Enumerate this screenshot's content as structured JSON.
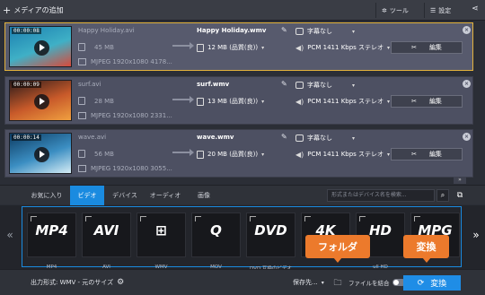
{
  "toolbar": {
    "add_media": "メディアの追加",
    "tools": "ツール",
    "settings": "設定"
  },
  "files": [
    {
      "duration": "00:00:08",
      "source_name": "Happy Holiday.avi",
      "source_size": "45 MB",
      "source_codec": "MJPEG 1920x1080 4178...",
      "output_name": "Happy Holiday.wmv",
      "output_size": "12 MB (品質(良))",
      "subtitle": "字幕なし",
      "audio": "PCM 1411 Kbps ステレオ",
      "edit_label": "編集",
      "selected": true,
      "thumb_colors": [
        "#1b7fb0",
        "#3fb0c6",
        "#d94a3a"
      ]
    },
    {
      "duration": "00:00:09",
      "source_name": "surf.avi",
      "source_size": "28 MB",
      "source_codec": "MJPEG 1920x1080 2331...",
      "output_name": "surf.wmv",
      "output_size": "13 MB (品質(良))",
      "subtitle": "字幕なし",
      "audio": "PCM 1411 Kbps ステレオ",
      "edit_label": "編集",
      "selected": false,
      "thumb_colors": [
        "#2c1b1a",
        "#c85a2a",
        "#f0a040"
      ]
    },
    {
      "duration": "00:00:14",
      "source_name": "wave.avi",
      "source_size": "56 MB",
      "source_codec": "MJPEG 1920x1080 3055...",
      "output_name": "wave.wmv",
      "output_size": "20 MB (品質(良))",
      "subtitle": "字幕なし",
      "audio": "PCM 1411 Kbps ステレオ",
      "edit_label": "編集",
      "selected": false,
      "thumb_colors": [
        "#0d3c63",
        "#3b8ec2",
        "#d5ecf5"
      ]
    }
  ],
  "tabs": [
    "お気に入り",
    "ビデオ",
    "デバイス",
    "オーディオ",
    "画像"
  ],
  "active_tab": "ビデオ",
  "search": {
    "placeholder": "形式またはデバイス名を検索..."
  },
  "formats": [
    {
      "logo": "MP4",
      "label": "MP4"
    },
    {
      "logo": "AVI",
      "label": "AVI"
    },
    {
      "logo": "⊞",
      "label": "WMV"
    },
    {
      "logo": "Q",
      "label": "MOV"
    },
    {
      "logo": "DVD",
      "label": "DVD 互換のビデオ"
    },
    {
      "logo": "4K",
      "label": ""
    },
    {
      "logo": "HD",
      "label": "ull HD"
    },
    {
      "logo": "MPG",
      "label": ""
    }
  ],
  "bottom": {
    "output_format": "出力形式: WMV - 元のサイズ",
    "save_to": "保存先...",
    "merge": "ファイルを結合",
    "convert": "変換"
  },
  "callouts": {
    "folder": "フォルダ",
    "convert": "変換"
  },
  "colors": {
    "accent": "#1a8be0",
    "callout": "#ec7a2c",
    "selection": "#e3b23c"
  }
}
